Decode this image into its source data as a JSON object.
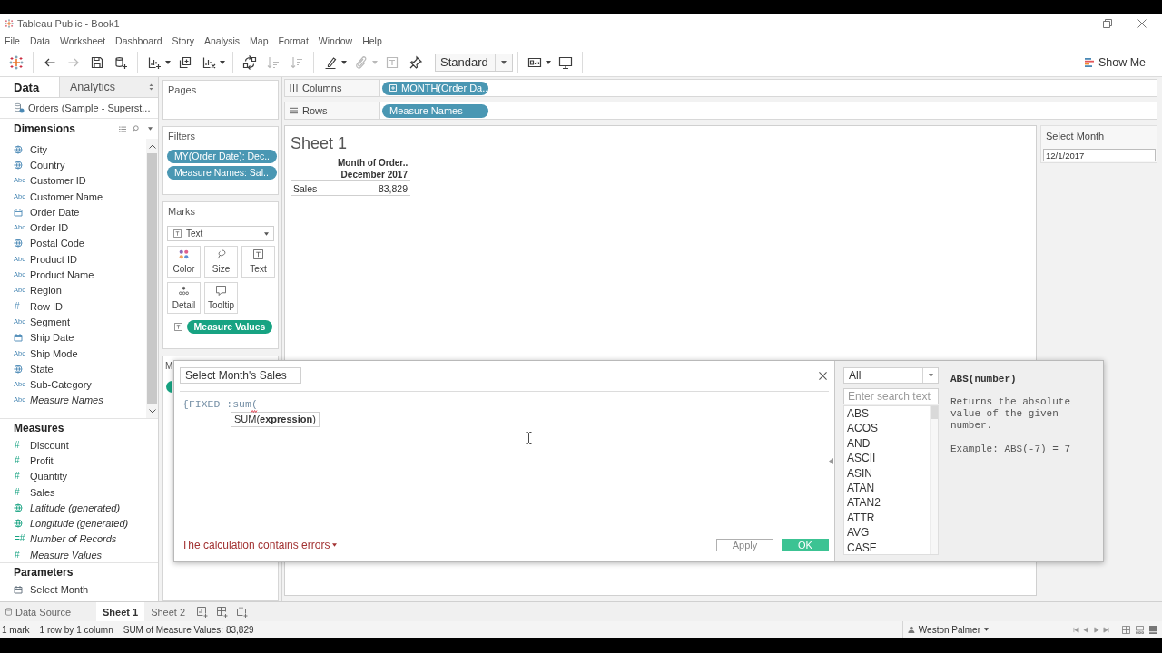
{
  "window": {
    "title": "Tableau Public - Book1"
  },
  "menu": [
    "File",
    "Data",
    "Worksheet",
    "Dashboard",
    "Story",
    "Analysis",
    "Map",
    "Format",
    "Window",
    "Help"
  ],
  "toolbar": {
    "groups": [
      [
        {
          "kind": "undo",
          "disabled": false
        },
        {
          "kind": "redo",
          "disabled": true
        },
        {
          "kind": "save",
          "disabled": false
        },
        {
          "kind": "datasource",
          "disabled": false
        }
      ],
      [
        {
          "kind": "newsheet",
          "disabled": false
        },
        {
          "kind": "duplicate",
          "disabled": false
        },
        {
          "kind": "clear",
          "disabled": false
        }
      ],
      [
        {
          "kind": "swap",
          "disabled": false
        },
        {
          "kind": "sortasc",
          "disabled": true
        },
        {
          "kind": "sortdesc",
          "disabled": true
        }
      ],
      [
        {
          "kind": "highlight",
          "disabled": false
        },
        {
          "kind": "group",
          "disabled": true
        },
        {
          "kind": "labels",
          "disabled": true
        },
        {
          "kind": "pin",
          "disabled": false
        },
        {
          "kind": "viewsize",
          "label": "Standard",
          "disabled": false
        }
      ],
      [
        {
          "kind": "cards",
          "disabled": false
        },
        {
          "kind": "present",
          "disabled": false
        }
      ]
    ],
    "show_me": "Show Me"
  },
  "data_pane": {
    "tabs": [
      {
        "label": "Data",
        "selected": true
      },
      {
        "label": "Analytics",
        "selected": false
      }
    ],
    "data_source": "Orders (Sample - Superst...",
    "sections": [
      {
        "title": "Dimensions",
        "kind": "dimension",
        "tools": true,
        "scrollable": true,
        "fields": [
          {
            "name": "City",
            "kind": "geo",
            "generated": false
          },
          {
            "name": "Country",
            "kind": "geo",
            "generated": false
          },
          {
            "name": "Customer ID",
            "kind": "text",
            "glyph": "Abc",
            "generated": false
          },
          {
            "name": "Customer Name",
            "kind": "text",
            "glyph": "Abc",
            "generated": false
          },
          {
            "name": "Order Date",
            "kind": "date",
            "generated": false
          },
          {
            "name": "Order ID",
            "kind": "text",
            "glyph": "Abc",
            "generated": false
          },
          {
            "name": "Postal Code",
            "kind": "geo",
            "generated": false
          },
          {
            "name": "Product ID",
            "kind": "text",
            "glyph": "Abc",
            "generated": false
          },
          {
            "name": "Product Name",
            "kind": "text",
            "glyph": "Abc",
            "generated": false
          },
          {
            "name": "Region",
            "kind": "text",
            "glyph": "Abc",
            "generated": false
          },
          {
            "name": "Row ID",
            "kind": "number",
            "glyph": "#",
            "generated": false
          },
          {
            "name": "Segment",
            "kind": "text",
            "glyph": "Abc",
            "generated": false
          },
          {
            "name": "Ship Date",
            "kind": "date",
            "generated": false
          },
          {
            "name": "Ship Mode",
            "kind": "text",
            "glyph": "Abc",
            "generated": false
          },
          {
            "name": "State",
            "kind": "geo",
            "generated": false
          },
          {
            "name": "Sub-Category",
            "kind": "text",
            "glyph": "Abc",
            "generated": false
          },
          {
            "name": "Measure Names",
            "kind": "text",
            "glyph": "Abc",
            "generated": true
          }
        ]
      },
      {
        "title": "Measures",
        "kind": "measure",
        "tools": false,
        "scrollable": false,
        "fields": [
          {
            "name": "Discount",
            "kind": "number",
            "glyph": "#",
            "generated": false
          },
          {
            "name": "Profit",
            "kind": "number",
            "glyph": "#",
            "generated": false
          },
          {
            "name": "Quantity",
            "kind": "number",
            "glyph": "#",
            "generated": false
          },
          {
            "name": "Sales",
            "kind": "number",
            "glyph": "#",
            "generated": false
          },
          {
            "name": "Latitude (generated)",
            "kind": "geo",
            "generated": true
          },
          {
            "name": "Longitude (generated)",
            "kind": "geo",
            "generated": true
          },
          {
            "name": "Number of Records",
            "kind": "number",
            "glyph": "=#",
            "generated": true
          },
          {
            "name": "Measure Values",
            "kind": "number",
            "glyph": "#",
            "generated": true
          }
        ]
      },
      {
        "title": "Parameters",
        "kind": "parameter",
        "tools": false,
        "scrollable": false,
        "fields": [
          {
            "name": "Select Month",
            "kind": "date",
            "generated": false
          }
        ]
      }
    ]
  },
  "shelves": {
    "pages": {
      "title": "Pages"
    },
    "filters": {
      "title": "Filters",
      "pills": [
        "MY(Order Date): Dec..",
        "Measure Names: Sal.."
      ]
    },
    "marks": {
      "title": "Marks",
      "mark_type": "Text",
      "properties": [
        {
          "kind": "color",
          "label": "Color"
        },
        {
          "kind": "size",
          "label": "Size"
        },
        {
          "kind": "text",
          "label": "Text"
        },
        {
          "kind": "detail",
          "label": "Detail"
        },
        {
          "kind": "tooltip",
          "label": "Tooltip"
        }
      ],
      "encodings": [
        {
          "kind": "text",
          "label": "Measure Values"
        }
      ]
    },
    "partial_card": {
      "title": "M"
    }
  },
  "columns_shelf": {
    "label": "Columns",
    "pills": [
      {
        "label": "MONTH(Order Da..",
        "expandable": true
      }
    ]
  },
  "rows_shelf": {
    "label": "Rows",
    "pills": [
      {
        "label": "Measure Names",
        "expandable": false
      }
    ]
  },
  "sheet": {
    "title": "Sheet 1",
    "column_header": [
      "Month of Order..",
      "December 2017"
    ],
    "rows": [
      {
        "label": "Sales",
        "value": "83,829"
      }
    ]
  },
  "parameter_control": {
    "title": "Select Month",
    "value": "12/1/2017"
  },
  "calculation_dialog": {
    "name": "Select Month's Sales",
    "formula": "{FIXED :sum(",
    "has_error": true,
    "autocomplete": "SUM(**expression**)",
    "error_message": "The calculation contains errors",
    "buttons": [
      {
        "label": "Apply",
        "kind": "secondary"
      },
      {
        "label": "OK",
        "kind": "primary"
      }
    ]
  },
  "function_panel": {
    "category": "All",
    "search": {
      "placeholder": "Enter search text"
    },
    "functions": [
      {
        "name": "ABS",
        "selected": false
      },
      {
        "name": "ACOS",
        "selected": false
      },
      {
        "name": "AND",
        "selected": false
      },
      {
        "name": "ASCII",
        "selected": false
      },
      {
        "name": "ASIN",
        "selected": false
      },
      {
        "name": "ATAN",
        "selected": false
      },
      {
        "name": "ATAN2",
        "selected": false
      },
      {
        "name": "ATTR",
        "selected": false
      },
      {
        "name": "AVG",
        "selected": false
      },
      {
        "name": "CASE",
        "selected": false
      }
    ],
    "help": {
      "signature": "ABS(number)",
      "description": "Returns the absolute value of the given number.",
      "example": "Example: ABS(-7) = 7"
    }
  },
  "sheet_tabs": [
    {
      "kind": "datasource",
      "label": "Data Source",
      "selected": false
    },
    {
      "kind": "sheet",
      "label": "Sheet 1",
      "selected": true
    },
    {
      "kind": "sheet",
      "label": "Sheet 2",
      "selected": false
    }
  ],
  "status_bar": {
    "items": [
      "1 mark",
      "1 row by 1 column",
      "SUM of Measure Values: 83,829"
    ],
    "user": "Weston Palmer"
  }
}
